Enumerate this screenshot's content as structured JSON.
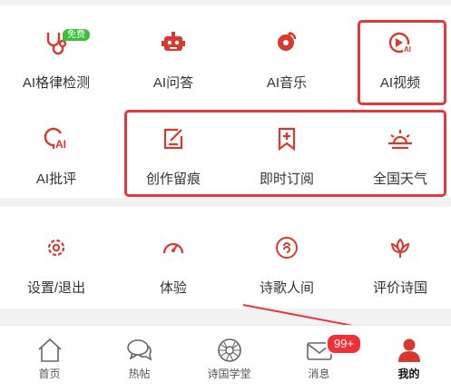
{
  "colors": {
    "accent": "#d8392f",
    "highlight": "#e8363c",
    "free_badge": "#3cbf3c",
    "message_badge": "#f0313a"
  },
  "grid": {
    "row1": [
      {
        "label": "AI格律检测",
        "icon": "stethoscope-icon",
        "badge": "免费"
      },
      {
        "label": "AI问答",
        "icon": "robot-icon"
      },
      {
        "label": "AI音乐",
        "icon": "music-note-icon"
      },
      {
        "label": "AI视频",
        "icon": "play-circle-ai-icon"
      }
    ],
    "row2": [
      {
        "label": "AI批评",
        "icon": "brain-ai-icon"
      },
      {
        "label": "创作留痕",
        "icon": "edit-note-icon"
      },
      {
        "label": "即时订阅",
        "icon": "bookmark-plus-icon"
      },
      {
        "label": "全国天气",
        "icon": "sunrise-icon"
      }
    ]
  },
  "settings": [
    {
      "label": "设置/退出",
      "icon": "gear-icon"
    },
    {
      "label": "体验",
      "icon": "speedometer-icon"
    },
    {
      "label": "诗歌人间",
      "icon": "swirl-circle-icon"
    },
    {
      "label": "评价诗国",
      "icon": "lotus-icon"
    }
  ],
  "tabbar": {
    "tabs": [
      {
        "label": "首页",
        "icon": "home-icon"
      },
      {
        "label": "热帖",
        "icon": "chat-bubbles-icon"
      },
      {
        "label": "诗国学堂",
        "icon": "aperture-icon"
      },
      {
        "label": "消息",
        "icon": "envelope-icon",
        "badge": "99+"
      },
      {
        "label": "我的",
        "icon": "person-icon",
        "active": true
      }
    ]
  }
}
